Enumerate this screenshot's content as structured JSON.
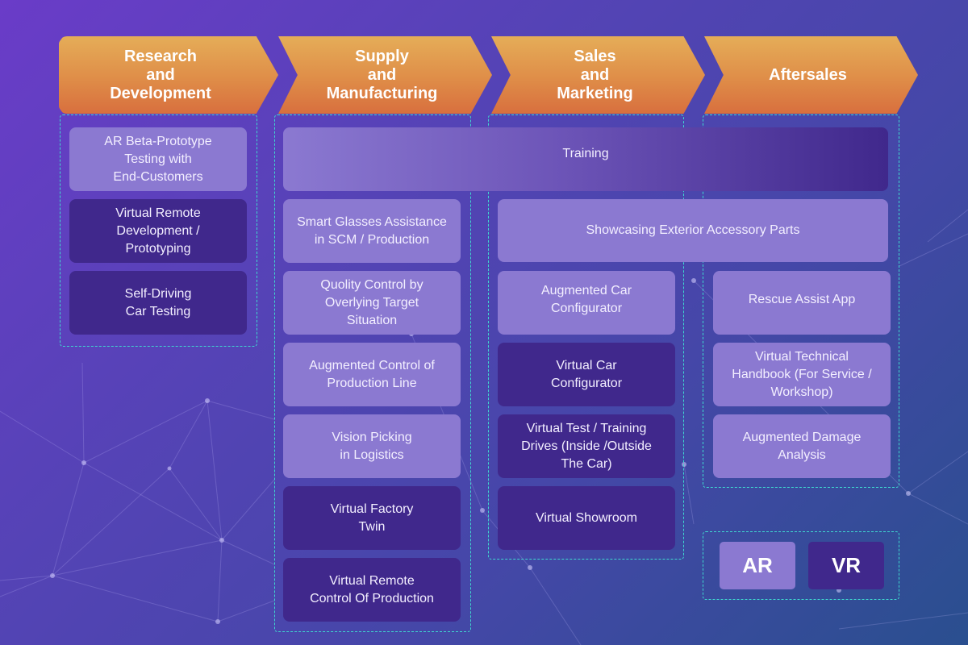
{
  "stages": [
    {
      "label": "Research\nand\nDevelopment"
    },
    {
      "label": "Supply\nand\nManufacturing"
    },
    {
      "label": "Sales\nand\nMarketing"
    },
    {
      "label": "Aftersales"
    }
  ],
  "cards": {
    "rd": [
      {
        "label": "AR Beta-Prototype\nTesting with\nEnd-Customers",
        "type": "AR"
      },
      {
        "label": "Virtual Remote\nDevelopment /\nPrototyping",
        "type": "VR"
      },
      {
        "label": "Self-Driving\nCar Testing",
        "type": "VR"
      }
    ],
    "training": {
      "label": "Training",
      "type": "AR+VR"
    },
    "showcasing": {
      "label": "Showcasing Exterior Accessory Parts",
      "type": "AR"
    },
    "supply": [
      {
        "label": "Smart Glasses Assistance\nin SCM / Production",
        "type": "AR"
      },
      {
        "label": "Quolity Control by\nOverlying Target\nSituation",
        "type": "AR"
      },
      {
        "label": "Augmented Control of\nProduction Line",
        "type": "AR"
      },
      {
        "label": "Vision Picking\nin Logistics",
        "type": "AR"
      },
      {
        "label": "Virtual Factory\nTwin",
        "type": "VR"
      },
      {
        "label": "Virtual Remote\nControl Of Production",
        "type": "VR"
      }
    ],
    "sales": [
      {
        "label": "Augmented Car\nConfigurator",
        "type": "AR"
      },
      {
        "label": "Virtual Car\nConfigurator",
        "type": "VR"
      },
      {
        "label": "Virtual Test / Training\nDrives (Inside /Outside\nThe Car)",
        "type": "VR"
      },
      {
        "label": "Virtual Showroom",
        "type": "VR"
      }
    ],
    "aftersales": [
      {
        "label": "Rescue Assist App",
        "type": "AR"
      },
      {
        "label": "Virtual Technical\nHandbook (For Service /\nWorkshop)",
        "type": "AR"
      },
      {
        "label": "Augmented Damage\nAnalysis",
        "type": "AR"
      }
    ]
  },
  "legend": {
    "ar": {
      "label": "AR",
      "color": "#8b79d1"
    },
    "vr": {
      "label": "VR",
      "color": "#40288c"
    }
  },
  "colors": {
    "stage_top": "#e5ad58",
    "stage_bottom": "#d86f3e",
    "zone_border": "#3fd8d0",
    "background_start": "#6a3cc8",
    "background_end": "#2a4f8f"
  }
}
